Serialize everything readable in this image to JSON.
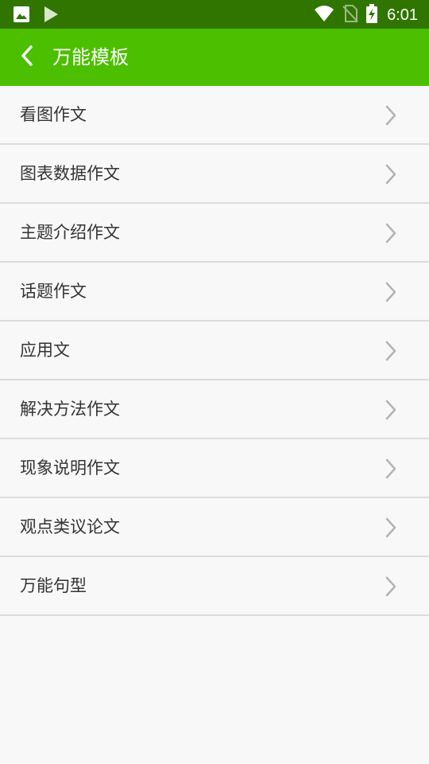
{
  "status_bar": {
    "time": "6:01",
    "left_icons": [
      "image-icon",
      "play-store-icon"
    ],
    "right_icons": [
      "wifi-icon",
      "no-sim-icon",
      "battery-charging-icon"
    ]
  },
  "app_bar": {
    "title": "万能模板",
    "back_icon": "chevron-left-icon",
    "background": "#4cbf00"
  },
  "list": {
    "items": [
      {
        "label": "看图作文"
      },
      {
        "label": "图表数据作文"
      },
      {
        "label": "主题介绍作文"
      },
      {
        "label": "话题作文"
      },
      {
        "label": "应用文"
      },
      {
        "label": "解决方法作文"
      },
      {
        "label": "现象说明作文"
      },
      {
        "label": "观点类议论文"
      },
      {
        "label": "万能句型"
      }
    ],
    "item_icon": "chevron-right-icon"
  }
}
